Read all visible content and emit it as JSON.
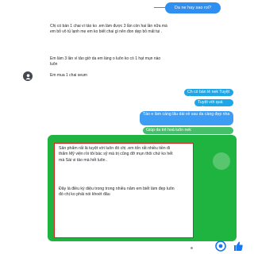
{
  "top_pill": {
    "text": "Da ne hay sao roi?"
  },
  "incoming": {
    "msg1": "Chị có bán 1 chai vì tảo ko .em làm được 3 lần còn hai lần nữa mà em bỏ vô tủ lạnh mẹ em ko biết chai gì nên đon dẹp bỏ mất tui .",
    "msg2": "Em làm 3 lần vì tảo giờ da em láng o luôn ko có 1 hạt mụn nào luôn",
    "msg3": "Em mua 1 chai seum"
  },
  "outgoing": [
    "Ch có bán lẻ nek Tuyệt ui",
    "Tuyệt vời quá nek",
    "Táo e làm càng lâu dài về sau da càng đẹp nha",
    "Giúp da trẻ hoá luôn nek"
  ],
  "card": {
    "text1": "Sản phẩm rất là tuyệt vời luôn đó chị .em tốn rất nhiều tiền đi thẩm Mỹ viện rồi tôi bác sỹ mà trị cũng đỡ mụn thôi chứ ko hết mà Sài vi tảo mà hết luôn .",
    "text2": "Đây là điều kỳ diệu trong trong nhiều năm em biết làm đẹp luôn đó chị ko phải nói khoét đâu"
  },
  "colors": {
    "accent_blue": "#2f8ff0",
    "bubble_blue": "#1da7e8",
    "bubble_green": "#45c06a",
    "card_green": "#1fb33f",
    "highlight_red": "#e02020"
  },
  "icons": {
    "avatar": "avatar-icon",
    "send": "send-icon",
    "like": "like-icon"
  }
}
